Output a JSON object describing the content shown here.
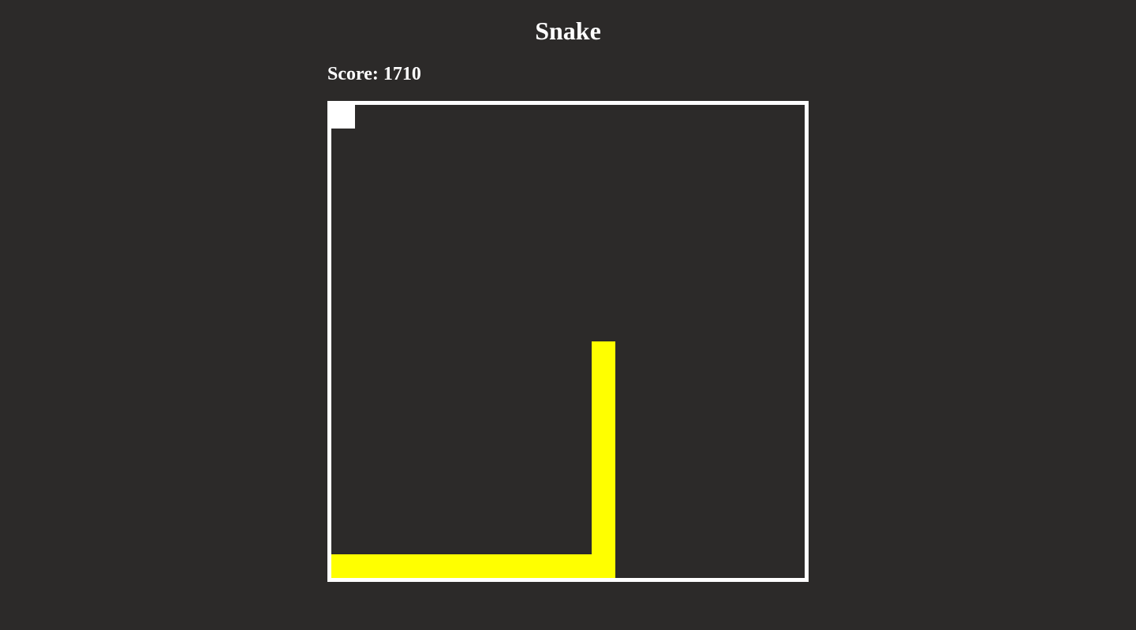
{
  "title": "Snake",
  "score": {
    "label": "Score:",
    "value": "1710"
  },
  "board": {
    "grid_cols": 20,
    "grid_rows": 20,
    "border_color": "#ffffff",
    "background_color": "#2c2a29"
  },
  "food": {
    "cell": [
      0,
      0
    ],
    "color": "#ffffff"
  },
  "snake": {
    "color": "#ffff00",
    "cells": [
      [
        11,
        10
      ],
      [
        11,
        11
      ],
      [
        11,
        12
      ],
      [
        11,
        13
      ],
      [
        11,
        14
      ],
      [
        11,
        15
      ],
      [
        11,
        16
      ],
      [
        11,
        17
      ],
      [
        11,
        18
      ],
      [
        11,
        19
      ],
      [
        10,
        19
      ],
      [
        9,
        19
      ],
      [
        8,
        19
      ],
      [
        7,
        19
      ],
      [
        6,
        19
      ],
      [
        5,
        19
      ],
      [
        4,
        19
      ],
      [
        3,
        19
      ],
      [
        2,
        19
      ],
      [
        1,
        19
      ],
      [
        0,
        19
      ]
    ]
  }
}
